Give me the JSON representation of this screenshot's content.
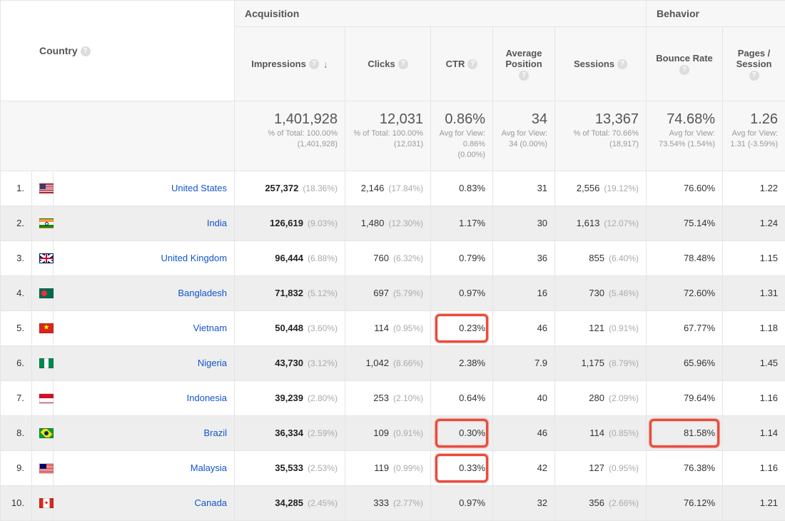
{
  "headers": {
    "country": "Country",
    "group_acquisition": "Acquisition",
    "group_behavior": "Behavior",
    "impressions": "Impressions",
    "clicks": "Clicks",
    "ctr": "CTR",
    "position": "Average Position",
    "sessions": "Sessions",
    "bounce": "Bounce Rate",
    "pages": "Pages / Session"
  },
  "summary": {
    "impressions": {
      "big": "1,401,928",
      "sub": "% of Total: 100.00% (1,401,928)"
    },
    "clicks": {
      "big": "12,031",
      "sub": "% of Total: 100.00% (12,031)"
    },
    "ctr": {
      "big": "0.86%",
      "sub": "Avg for View: 0.86% (0.00%)"
    },
    "position": {
      "big": "34",
      "sub": "Avg for View: 34 (0.00%)"
    },
    "sessions": {
      "big": "13,367",
      "sub": "% of Total: 70.66% (18,917)"
    },
    "bounce": {
      "big": "74.68%",
      "sub": "Avg for View: 73.54% (1.54%)"
    },
    "pages": {
      "big": "1.26",
      "sub": "Avg for View: 1.31 (-3.59%)"
    }
  },
  "rows": [
    {
      "rank": "1.",
      "flag": "us",
      "country": "United States",
      "impr": "257,372",
      "impr_pct": "(18.36%)",
      "clicks": "2,146",
      "clicks_pct": "(17.84%)",
      "ctr": "0.83%",
      "pos": "31",
      "sess": "2,556",
      "sess_pct": "(19.12%)",
      "bounce": "76.60%",
      "pages": "1.22"
    },
    {
      "rank": "2.",
      "flag": "in",
      "country": "India",
      "impr": "126,619",
      "impr_pct": "(9.03%)",
      "clicks": "1,480",
      "clicks_pct": "(12.30%)",
      "ctr": "1.17%",
      "pos": "30",
      "sess": "1,613",
      "sess_pct": "(12.07%)",
      "bounce": "75.14%",
      "pages": "1.24"
    },
    {
      "rank": "3.",
      "flag": "gb",
      "country": "United Kingdom",
      "impr": "96,444",
      "impr_pct": "(6.88%)",
      "clicks": "760",
      "clicks_pct": "(6.32%)",
      "ctr": "0.79%",
      "pos": "36",
      "sess": "855",
      "sess_pct": "(6.40%)",
      "bounce": "78.48%",
      "pages": "1.15"
    },
    {
      "rank": "4.",
      "flag": "bd",
      "country": "Bangladesh",
      "impr": "71,832",
      "impr_pct": "(5.12%)",
      "clicks": "697",
      "clicks_pct": "(5.79%)",
      "ctr": "0.97%",
      "pos": "16",
      "sess": "730",
      "sess_pct": "(5.46%)",
      "bounce": "72.60%",
      "pages": "1.31"
    },
    {
      "rank": "5.",
      "flag": "vn",
      "country": "Vietnam",
      "impr": "50,448",
      "impr_pct": "(3.60%)",
      "clicks": "114",
      "clicks_pct": "(0.95%)",
      "ctr": "0.23%",
      "pos": "46",
      "sess": "121",
      "sess_pct": "(0.91%)",
      "bounce": "67.77%",
      "pages": "1.18",
      "highlight": [
        "ctr"
      ]
    },
    {
      "rank": "6.",
      "flag": "ng",
      "country": "Nigeria",
      "impr": "43,730",
      "impr_pct": "(3.12%)",
      "clicks": "1,042",
      "clicks_pct": "(8.66%)",
      "ctr": "2.38%",
      "pos": "7.9",
      "sess": "1,175",
      "sess_pct": "(8.79%)",
      "bounce": "65.96%",
      "pages": "1.45"
    },
    {
      "rank": "7.",
      "flag": "id",
      "country": "Indonesia",
      "impr": "39,239",
      "impr_pct": "(2.80%)",
      "clicks": "253",
      "clicks_pct": "(2.10%)",
      "ctr": "0.64%",
      "pos": "40",
      "sess": "280",
      "sess_pct": "(2.09%)",
      "bounce": "79.64%",
      "pages": "1.16"
    },
    {
      "rank": "8.",
      "flag": "br",
      "country": "Brazil",
      "impr": "36,334",
      "impr_pct": "(2.59%)",
      "clicks": "109",
      "clicks_pct": "(0.91%)",
      "ctr": "0.30%",
      "pos": "46",
      "sess": "114",
      "sess_pct": "(0.85%)",
      "bounce": "81.58%",
      "pages": "1.14",
      "highlight": [
        "ctr",
        "bounce"
      ]
    },
    {
      "rank": "9.",
      "flag": "my",
      "country": "Malaysia",
      "impr": "35,533",
      "impr_pct": "(2.53%)",
      "clicks": "119",
      "clicks_pct": "(0.99%)",
      "ctr": "0.33%",
      "pos": "42",
      "sess": "127",
      "sess_pct": "(0.95%)",
      "bounce": "76.38%",
      "pages": "1.16",
      "highlight": [
        "ctr"
      ]
    },
    {
      "rank": "10.",
      "flag": "ca",
      "country": "Canada",
      "impr": "34,285",
      "impr_pct": "(2.45%)",
      "clicks": "333",
      "clicks_pct": "(2.77%)",
      "ctr": "0.97%",
      "pos": "32",
      "sess": "356",
      "sess_pct": "(2.66%)",
      "bounce": "76.12%",
      "pages": "1.21"
    }
  ]
}
